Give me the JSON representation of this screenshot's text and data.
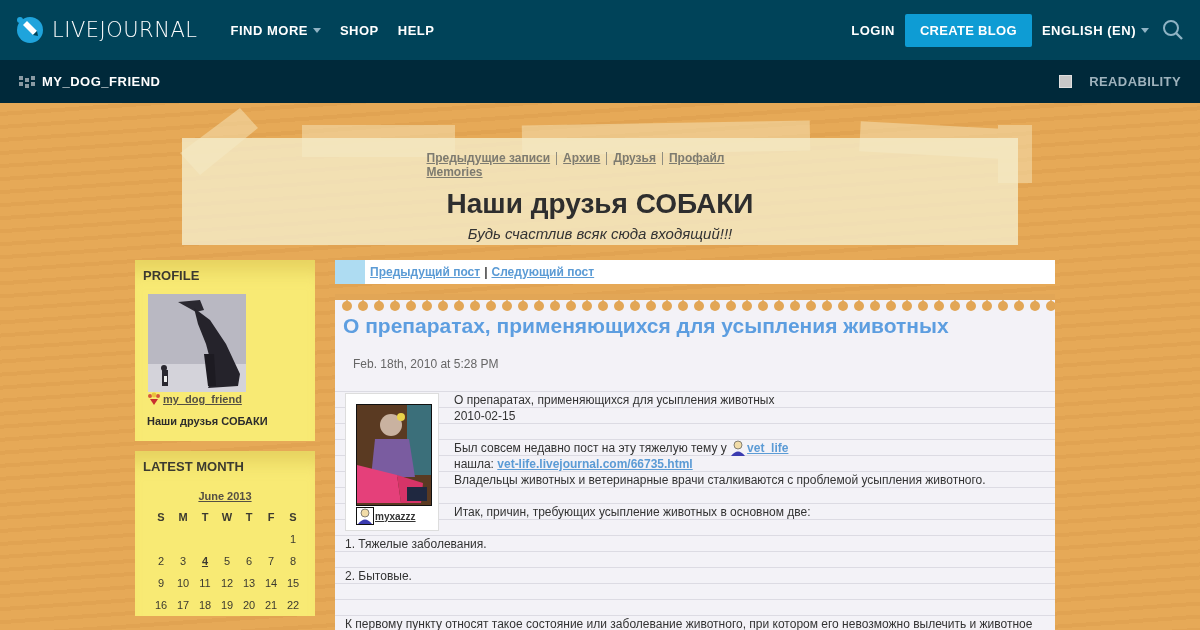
{
  "topbar": {
    "logo": "LIVEJOURNAL",
    "nav": [
      {
        "label": "FIND MORE",
        "dropdown": true
      },
      {
        "label": "SHOP",
        "dropdown": false
      },
      {
        "label": "HELP",
        "dropdown": false
      }
    ],
    "login": "LOGIN",
    "create_blog": "CREATE BLOG",
    "language": {
      "label": "ENGLISH (EN)",
      "dropdown": true
    }
  },
  "subbar": {
    "journal": "MY_DOG_FRIEND",
    "readability": {
      "label": "READABILITY",
      "checked": false
    }
  },
  "header": {
    "link_rows": [
      [
        "Предыдущие записи",
        "Архив",
        "Друзья",
        "Профайл"
      ],
      [
        "Memories"
      ]
    ],
    "title": "Наши друзья СОБАКИ",
    "subtitle": "Будь счастлив всяк сюда входящий!!!"
  },
  "sidebar": {
    "profile": {
      "heading": "PROFILE",
      "username": "my_dog_friend",
      "description": "Наши друзья СОБАКИ"
    },
    "latest_month": {
      "heading": "LATEST MONTH",
      "month": "June 2013",
      "weekdays": [
        "S",
        "M",
        "T",
        "W",
        "T",
        "F",
        "S"
      ],
      "weeks": [
        [
          {
            "day": "1",
            "linked": false
          }
        ],
        [
          {
            "day": "2",
            "linked": false
          },
          {
            "day": "3",
            "linked": false
          },
          {
            "day": "4",
            "linked": true
          },
          {
            "day": "5",
            "linked": false
          },
          {
            "day": "6",
            "linked": false
          },
          {
            "day": "7",
            "linked": false
          },
          {
            "day": "8",
            "linked": false
          }
        ],
        [
          {
            "day": "9",
            "linked": false
          },
          {
            "day": "10",
            "linked": false
          },
          {
            "day": "11",
            "linked": false
          },
          {
            "day": "12",
            "linked": false
          },
          {
            "day": "13",
            "linked": false
          },
          {
            "day": "14",
            "linked": false
          },
          {
            "day": "15",
            "linked": false
          }
        ],
        [
          {
            "day": "16",
            "linked": false
          },
          {
            "day": "17",
            "linked": false
          },
          {
            "day": "18",
            "linked": false
          },
          {
            "day": "19",
            "linked": false
          },
          {
            "day": "20",
            "linked": false
          },
          {
            "day": "21",
            "linked": false
          },
          {
            "day": "22",
            "linked": false
          }
        ]
      ]
    }
  },
  "post_nav": {
    "previous": "Предыдущий пост",
    "separator": "|",
    "next": "Следующий пост"
  },
  "post": {
    "title": "О препаратах, применяющихся для усыпления животных",
    "date": "Feb. 18th, 2010 at 5:28 PM",
    "author": "myxazzz",
    "lines": [
      {
        "kind": "text",
        "parts": [
          {
            "kind": "text",
            "text": "О препаратах, применяющихся для усыпления животных"
          }
        ]
      },
      {
        "kind": "text",
        "parts": [
          {
            "kind": "text",
            "text": "2010-02-15"
          }
        ]
      },
      {
        "kind": "gap"
      },
      {
        "kind": "text",
        "parts": [
          {
            "kind": "text",
            "text": "Был совсем недавно пост на эту тяжелую тему у"
          },
          {
            "kind": "user",
            "text": "vet_life"
          }
        ]
      },
      {
        "kind": "text",
        "parts": [
          {
            "kind": "text",
            "text": "нашла:"
          },
          {
            "kind": "link",
            "text": "vet-life.livejournal.com/66735.html"
          }
        ]
      },
      {
        "kind": "text",
        "parts": [
          {
            "kind": "text",
            "text": "Владельцы животных и ветеринарные врачи сталкиваются с проблемой усыпления животного."
          }
        ]
      },
      {
        "kind": "gap"
      },
      {
        "kind": "text",
        "parts": [
          {
            "kind": "text",
            "text": "Итак, причин, требующих усыпление животных в основном две:"
          }
        ]
      },
      {
        "kind": "gap"
      },
      {
        "kind": "text",
        "parts": [
          {
            "kind": "text",
            "text": "1. Тяжелые заболевания."
          }
        ]
      },
      {
        "kind": "gap"
      },
      {
        "kind": "text",
        "parts": [
          {
            "kind": "text",
            "text": "2. Бытовые."
          }
        ]
      },
      {
        "kind": "gap"
      },
      {
        "kind": "gap"
      },
      {
        "kind": "text",
        "parts": [
          {
            "kind": "text",
            "text": "К первому пункту относят такое состояние или заболевание животного, при котором его невозможно вылечить и животное"
          }
        ]
      }
    ]
  }
}
